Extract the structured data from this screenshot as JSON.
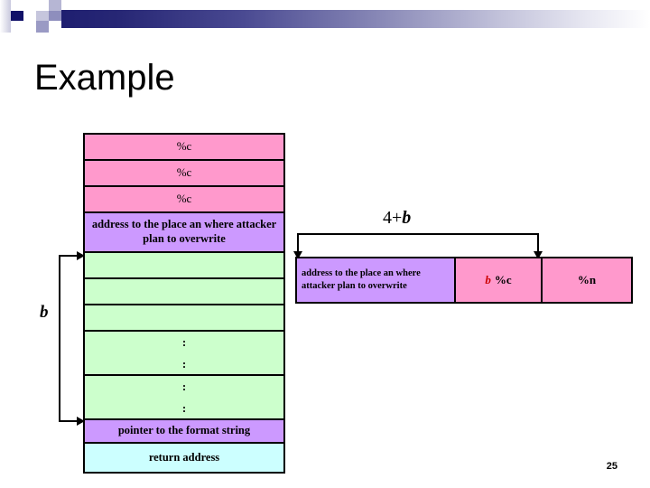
{
  "slide": {
    "title": "Example",
    "page_number": "25"
  },
  "theme": {
    "pink": "#ff99cc",
    "purple": "#cc99ff",
    "green": "#ccffcc",
    "cyan": "#ccffff",
    "accent_red": "#cc0000",
    "band_dark": "#1b1b6e",
    "border": "#000000"
  },
  "stack_table": {
    "rows": [
      {
        "label": "%c",
        "color": "pink"
      },
      {
        "label": "%c",
        "color": "pink"
      },
      {
        "label": "%c",
        "color": "pink"
      },
      {
        "label": "address to the place an where attacker plan to overwrite",
        "color": "purple"
      },
      {
        "label": "",
        "color": "green"
      },
      {
        "label": "",
        "color": "green"
      },
      {
        "label": "",
        "color": "green"
      },
      {
        "label": ":",
        "label2": ":",
        "color": "green"
      },
      {
        "label": ":",
        "label2": ":",
        "color": "green"
      },
      {
        "label": "pointer to the format  string",
        "color": "purple"
      },
      {
        "label": "return address",
        "color": "cyan"
      }
    ]
  },
  "brackets": {
    "stack_span_label": "b",
    "input_span_label_prefix": "4+",
    "input_span_label_var": "b"
  },
  "input_table": {
    "cells": [
      {
        "text": "address to the place an where attacker plan to overwrite",
        "color": "purple"
      },
      {
        "var": "b",
        "text": "%c",
        "color": "pink"
      },
      {
        "text": "%n",
        "color": "pink"
      }
    ]
  }
}
